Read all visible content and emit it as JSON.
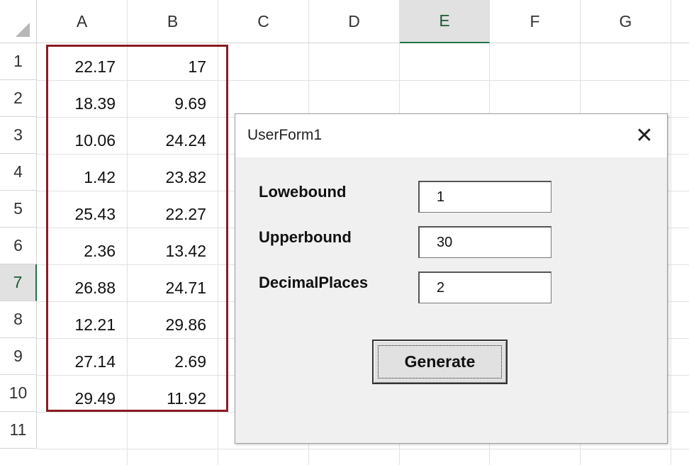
{
  "columns": [
    "A",
    "B",
    "C",
    "D",
    "E",
    "F",
    "G"
  ],
  "selected_column": "E",
  "rows": [
    "1",
    "2",
    "3",
    "4",
    "5",
    "6",
    "7",
    "8",
    "9",
    "10",
    "11"
  ],
  "selected_row": "7",
  "data": {
    "A": [
      "22.17",
      "18.39",
      "10.06",
      "1.42",
      "25.43",
      "2.36",
      "26.88",
      "12.21",
      "27.14",
      "29.49"
    ],
    "B": [
      "17",
      "9.69",
      "24.24",
      "23.82",
      "22.27",
      "13.42",
      "24.71",
      "29.86",
      "2.69",
      "11.92"
    ]
  },
  "userform": {
    "title": "UserForm1",
    "close_glyph": "✕",
    "fields": [
      {
        "label": "Lowebound",
        "value": "1"
      },
      {
        "label": "Upperbound",
        "value": "30"
      },
      {
        "label": "DecimalPlaces",
        "value": "2"
      }
    ],
    "button_label": "Generate"
  }
}
